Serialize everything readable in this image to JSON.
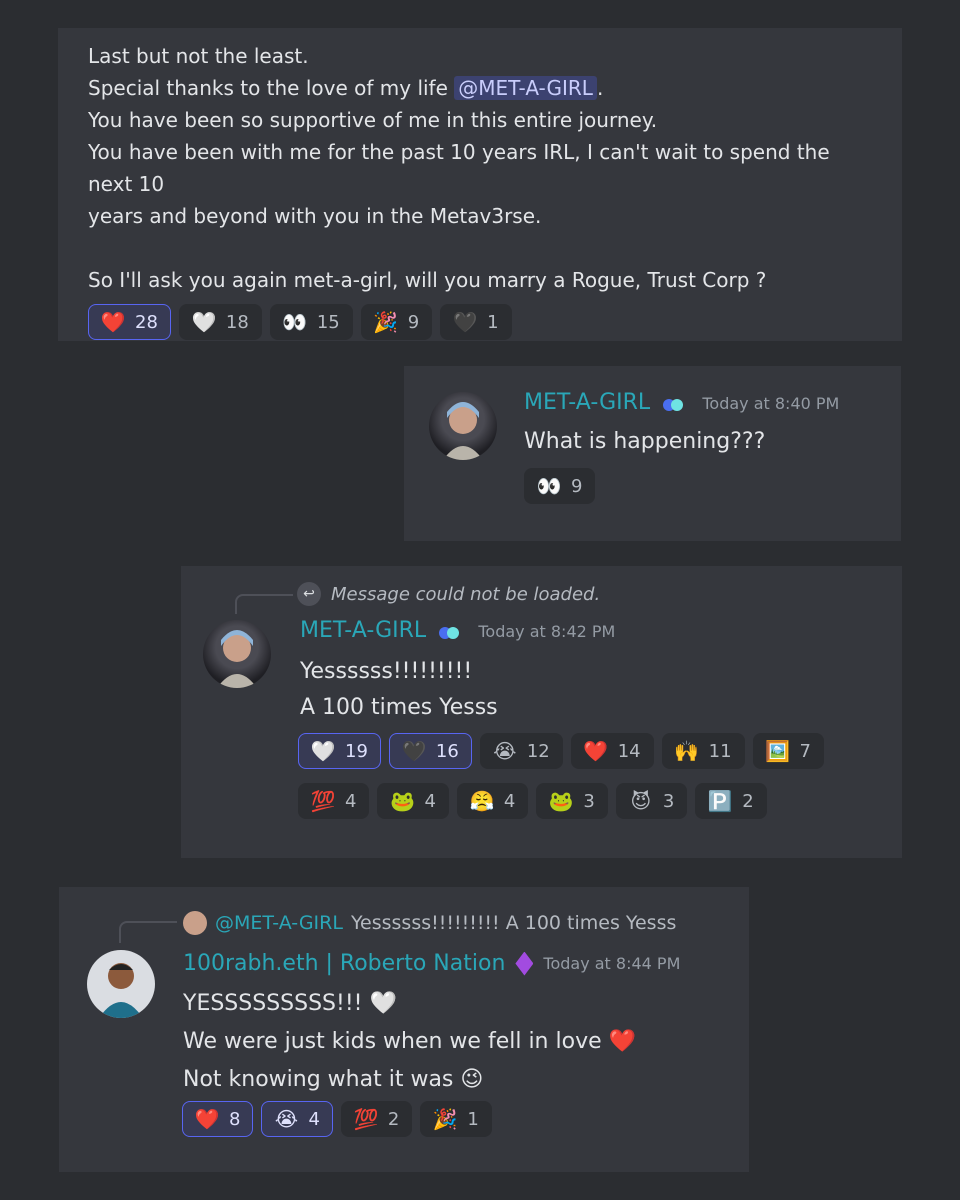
{
  "message1": {
    "lines": [
      "Last but not the least.",
      "Special thanks to the love of my life",
      "You have been so supportive of me in this entire journey.",
      "You have been with me for the past 10 years IRL, I can't wait to spend the next 10",
      "years and beyond with you in the Metav3rse.",
      "So I'll ask you again met-a-girl, will you marry a Rogue, Trust Corp ?"
    ],
    "mention": "@MET-A-GIRL",
    "mention_suffix": ".",
    "reactions": [
      {
        "emoji": "❤️",
        "icon": "red-heart-icon",
        "count": "28",
        "active": true
      },
      {
        "emoji": "🤍",
        "icon": "white-heart-icon",
        "count": "18",
        "active": false
      },
      {
        "emoji": "👀",
        "icon": "eyes-icon",
        "count": "15",
        "active": false
      },
      {
        "emoji": "🎉",
        "icon": "party-popper-icon",
        "count": "9",
        "active": false
      },
      {
        "emoji": "🖤",
        "icon": "dark-heart-icon",
        "count": "1",
        "active": false
      }
    ]
  },
  "message2": {
    "username": "MET-A-GIRL",
    "timestamp": "Today at 8:40 PM",
    "text": "What is happening???",
    "reactions": [
      {
        "emoji": "👀",
        "icon": "eyes-icon",
        "count": "9",
        "active": false
      }
    ]
  },
  "message3": {
    "reply_text": "Message could not be loaded.",
    "username": "MET-A-GIRL",
    "timestamp": "Today at 8:42 PM",
    "lines": [
      "Yessssss!!!!!!!!!",
      "A 100 times Yesss"
    ],
    "reactions": [
      {
        "emoji": "🤍",
        "icon": "white-heart-icon",
        "count": "19",
        "active": true
      },
      {
        "emoji": "🖤",
        "icon": "dark-heart-icon",
        "count": "16",
        "active": true
      },
      {
        "emoji": "😭",
        "icon": "crying-face-icon",
        "count": "12",
        "active": false
      },
      {
        "emoji": "❤️",
        "icon": "red-heart-icon",
        "count": "14",
        "active": false
      },
      {
        "emoji": "🙌",
        "icon": "raised-hands-icon",
        "count": "11",
        "active": false
      },
      {
        "emoji": "🖼️",
        "icon": "pixel-art-icon",
        "count": "7",
        "active": false
      },
      {
        "emoji": "💯",
        "icon": "hundred-points-icon",
        "count": "4",
        "active": false
      },
      {
        "emoji": "🐸",
        "icon": "pepe-hat-icon",
        "count": "4",
        "active": false
      },
      {
        "emoji": "😤",
        "icon": "steam-face-icon",
        "count": "4",
        "active": false
      },
      {
        "emoji": "🐸",
        "icon": "pepe-laugh-icon",
        "count": "3",
        "active": false
      },
      {
        "emoji": "😈",
        "icon": "devil-face-icon",
        "count": "3",
        "active": false
      },
      {
        "emoji": "🅿️",
        "icon": "p-button-icon",
        "count": "2",
        "active": false
      }
    ]
  },
  "message4": {
    "reply_user": "@MET-A-GIRL",
    "reply_text": "Yessssss!!!!!!!!! A 100 times Yesss",
    "username": "100rabh.eth | Roberto Nation",
    "timestamp": "Today at 8:44 PM",
    "lines": [
      "YESSSSSSSSS!!! 🤍",
      "We were just kids when we fell in love ❤️",
      "Not knowing what it was 😉"
    ],
    "reactions": [
      {
        "emoji": "❤️",
        "icon": "red-heart-icon",
        "count": "8",
        "active": true
      },
      {
        "emoji": "😭",
        "icon": "crying-face-icon",
        "count": "4",
        "active": true
      },
      {
        "emoji": "💯",
        "icon": "hundred-points-icon",
        "count": "2",
        "active": false
      },
      {
        "emoji": "🎉",
        "icon": "party-popper-icon",
        "count": "1",
        "active": false
      }
    ]
  },
  "colors": {
    "background": "#2b2d31",
    "card": "#35373d",
    "username": "#2aa7b8",
    "accent": "#5865f2"
  }
}
